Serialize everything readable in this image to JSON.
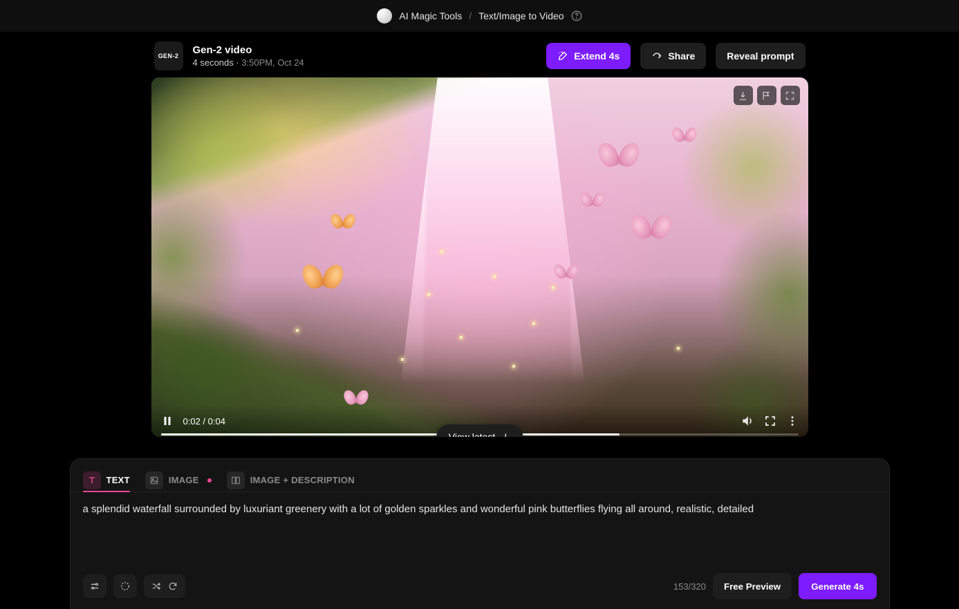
{
  "topbar": {
    "breadcrumb_root": "AI Magic Tools",
    "breadcrumb_current": "Text/Image to Video"
  },
  "header": {
    "badge_text": "GEN-2",
    "title": "Gen-2 video",
    "duration": "4 seconds",
    "separator": " · ",
    "timestamp": "3:50PM, Oct 24",
    "extend_label": "Extend 4s",
    "share_label": "Share",
    "reveal_label": "Reveal prompt"
  },
  "video": {
    "time_label": "0:02 / 0:04",
    "view_latest_label": "View latest",
    "icons": {
      "download": "download-icon",
      "flag": "flag-icon",
      "expand": "fullscreen-icon",
      "pause": "pause-icon",
      "volume": "volume-icon",
      "full": "fullscreen-icon",
      "more": "more-vertical-icon"
    }
  },
  "tabs": {
    "text": "TEXT",
    "image": "IMAGE",
    "image_desc": "IMAGE + DESCRIPTION"
  },
  "prompt": {
    "value": "a splendid waterfall surrounded by luxuriant greenery with a lot of golden sparkles and wonderful pink butterflies flying all around, realistic, detailed"
  },
  "footer": {
    "counter": "153/320",
    "free_preview": "Free Preview",
    "generate": "Generate 4s"
  },
  "colors": {
    "accent_purple": "#7c1cff",
    "accent_pink": "#ec4899"
  }
}
